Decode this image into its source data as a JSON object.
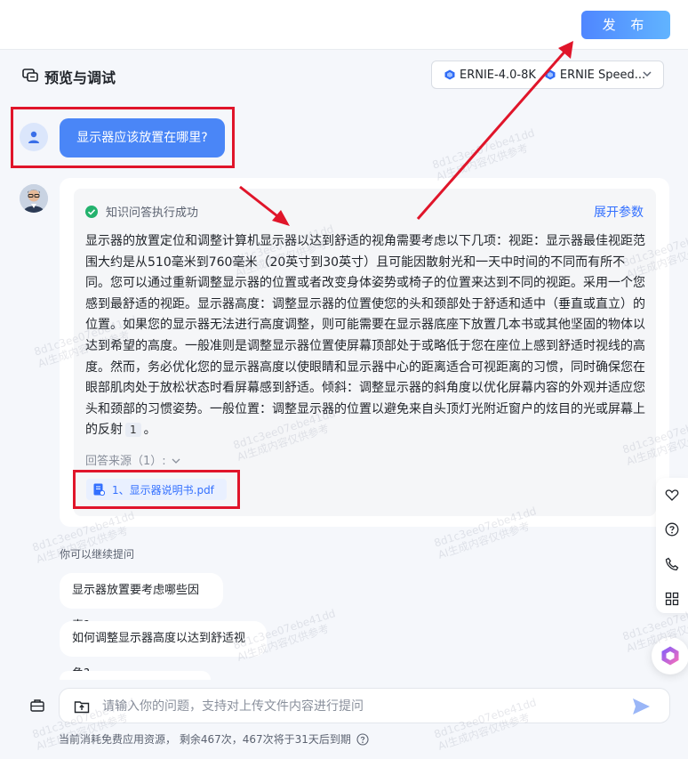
{
  "header": {
    "publish_label": "发 布"
  },
  "panel": {
    "title": "预览与调试",
    "models": [
      "ERNIE-4.0-8K",
      "ERNIE Speed..."
    ]
  },
  "chat": {
    "user_question": "显示器应该放置在哪里?",
    "status_text": "知识问答执行成功",
    "expand_label": "展开参数",
    "answer_text": "显示器的放置定位和调整计算机显示器以达到舒适的视角需要考虑以下几项：视距：显示器最佳视距范围大约是从510毫米到760毫米（20英寸到30英寸）且可能因散射光和一天中时间的不同而有所不同。您可以通过重新调整显示器的位置或者改变身体姿势或椅子的位置来达到不同的视距。采用一个您感到最舒适的视距。显示器高度：调整显示器的位置使您的头和颈部处于舒适和适中（垂直或直立）的位置。如果您的显示器无法进行高度调整，则可能需要在显示器底座下放置几本书或其他坚固的物体以达到希望的高度。一般准则是调整显示器位置使屏幕顶部处于或略低于您在座位上感到舒适时视线的高度。然而，务必优化您的显示器高度以使眼睛和显示器中心的距离适合可视距离的习惯，同时确保您在眼部肌肉处于放松状态时看屏幕感到舒适。倾斜：调整显示器的斜角度以优化屏幕内容的外观并适应您头和颈部的习惯姿势。一般位置：调整显示器的位置以避免来自头顶灯光附近窗户的炫目的光或屏幕上的反射",
    "citation": "1",
    "answer_end": "。",
    "source_label": "回答来源（1）:",
    "source_file": "1、显示器说明书.pdf",
    "continue_hint": "你可以继续提问",
    "suggestions": [
      "显示器放置要考虑哪些因素?",
      "如何调整显示器高度以达到舒适视角?"
    ]
  },
  "input": {
    "placeholder": "请输入你的问题，支持对上传文件内容进行提问",
    "quota_text": "当前消耗免费应用资源， 剩余467次，467次将于31天后到期"
  },
  "watermark": {
    "line1": "8d1c3ee07ebe41dd",
    "line2": "AI生成内容仅供参考"
  },
  "icons": {
    "chat_preview": "chat-bubble-icon",
    "model": "cube-icon",
    "user": "person-icon",
    "check": "check-circle-icon",
    "file": "pdf-file-icon",
    "upload": "upload-folder-icon",
    "send": "send-arrow-icon",
    "toolbox": "toolbox-icon"
  },
  "colors": {
    "accent": "#3370ff",
    "user_bubble": "#4a86f7",
    "annotation_red": "#e0152a",
    "success": "#23b26d"
  }
}
